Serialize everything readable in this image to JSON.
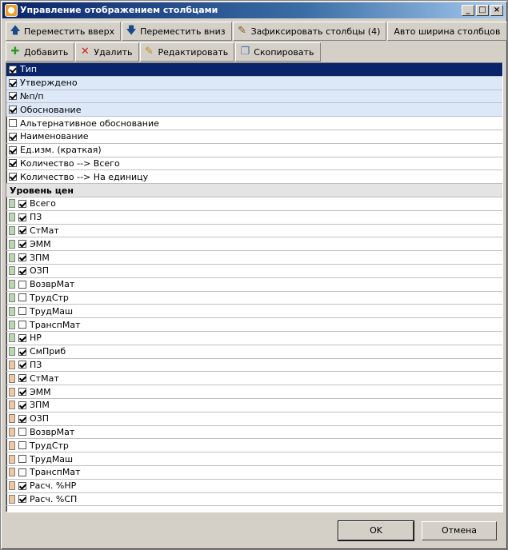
{
  "window": {
    "title": "Управление отображением столбцами",
    "minimize": "_",
    "maximize": "□",
    "close": "×"
  },
  "toolbar1": [
    {
      "label": "Переместить вверх",
      "icon": "arrow-up-icon",
      "glyph": "🡅",
      "color": "#1a4a8a"
    },
    {
      "label": "Переместить вниз",
      "icon": "arrow-down-icon",
      "glyph": "🡇",
      "color": "#1a4a8a"
    },
    {
      "label": "Зафиксировать столбцы (4)",
      "icon": "pin-icon",
      "glyph": "✎",
      "color": "#8a5a1a"
    },
    {
      "label": "Авто ширина столбцов",
      "icon": "",
      "glyph": "",
      "color": ""
    }
  ],
  "toolbar2": [
    {
      "label": "Добавить",
      "icon": "plus-icon",
      "glyph": "✚",
      "color": "#2a9a2a"
    },
    {
      "label": "Удалить",
      "icon": "delete-x-icon",
      "glyph": "✕",
      "color": "#d02020"
    },
    {
      "label": "Редактировать",
      "icon": "edit-icon",
      "glyph": "✎",
      "color": "#c08a20"
    },
    {
      "label": "Скопировать",
      "icon": "copy-icon",
      "glyph": "❐",
      "color": "#4070b0"
    }
  ],
  "rows": [
    {
      "kind": "item",
      "label": "Тип",
      "checked": true,
      "style": "selected"
    },
    {
      "kind": "item",
      "label": "Утверждено",
      "checked": true,
      "style": "blue"
    },
    {
      "kind": "item",
      "label": "№п/п",
      "checked": true,
      "style": "blue"
    },
    {
      "kind": "item",
      "label": "Обоснование",
      "checked": true,
      "style": "blue"
    },
    {
      "kind": "item",
      "label": "Альтернативное обоснование",
      "checked": false,
      "style": ""
    },
    {
      "kind": "item",
      "label": "Наименование",
      "checked": true,
      "style": ""
    },
    {
      "kind": "item",
      "label": "Ед.изм. (краткая)",
      "checked": true,
      "style": ""
    },
    {
      "kind": "item",
      "label": "Количество --> Всего",
      "checked": true,
      "style": ""
    },
    {
      "kind": "item",
      "label": "Количество --> На единицу",
      "checked": true,
      "style": ""
    },
    {
      "kind": "header",
      "label": "Уровень цен"
    },
    {
      "kind": "item",
      "label": "Всего",
      "checked": true,
      "swatch": "green"
    },
    {
      "kind": "item",
      "label": "ПЗ",
      "checked": true,
      "swatch": "green"
    },
    {
      "kind": "item",
      "label": "СтМат",
      "checked": true,
      "swatch": "green"
    },
    {
      "kind": "item",
      "label": "ЭММ",
      "checked": true,
      "swatch": "green"
    },
    {
      "kind": "item",
      "label": "ЗПМ",
      "checked": true,
      "swatch": "green"
    },
    {
      "kind": "item",
      "label": "ОЗП",
      "checked": true,
      "swatch": "green"
    },
    {
      "kind": "item",
      "label": "ВозврМат",
      "checked": false,
      "swatch": "green"
    },
    {
      "kind": "item",
      "label": "ТрудСтр",
      "checked": false,
      "swatch": "green"
    },
    {
      "kind": "item",
      "label": "ТрудМаш",
      "checked": false,
      "swatch": "green"
    },
    {
      "kind": "item",
      "label": "ТранспМат",
      "checked": false,
      "swatch": "green"
    },
    {
      "kind": "item",
      "label": "НР",
      "checked": true,
      "swatch": "green"
    },
    {
      "kind": "item",
      "label": "СмПриб",
      "checked": true,
      "swatch": "green"
    },
    {
      "kind": "item",
      "label": "ПЗ",
      "checked": true,
      "swatch": "orange"
    },
    {
      "kind": "item",
      "label": "СтМат",
      "checked": true,
      "swatch": "orange"
    },
    {
      "kind": "item",
      "label": "ЭММ",
      "checked": true,
      "swatch": "orange"
    },
    {
      "kind": "item",
      "label": "ЗПМ",
      "checked": true,
      "swatch": "orange"
    },
    {
      "kind": "item",
      "label": "ОЗП",
      "checked": true,
      "swatch": "orange"
    },
    {
      "kind": "item",
      "label": "ВозврМат",
      "checked": false,
      "swatch": "orange"
    },
    {
      "kind": "item",
      "label": "ТрудСтр",
      "checked": false,
      "swatch": "orange"
    },
    {
      "kind": "item",
      "label": "ТрудМаш",
      "checked": false,
      "swatch": "orange"
    },
    {
      "kind": "item",
      "label": "ТранспМат",
      "checked": false,
      "swatch": "orange"
    },
    {
      "kind": "item",
      "label": "Расч. %НР",
      "checked": true,
      "swatch": "orange"
    },
    {
      "kind": "item",
      "label": "Расч. %СП",
      "checked": true,
      "swatch": "orange"
    }
  ],
  "footer": {
    "ok": "OK",
    "cancel": "Отмена"
  }
}
